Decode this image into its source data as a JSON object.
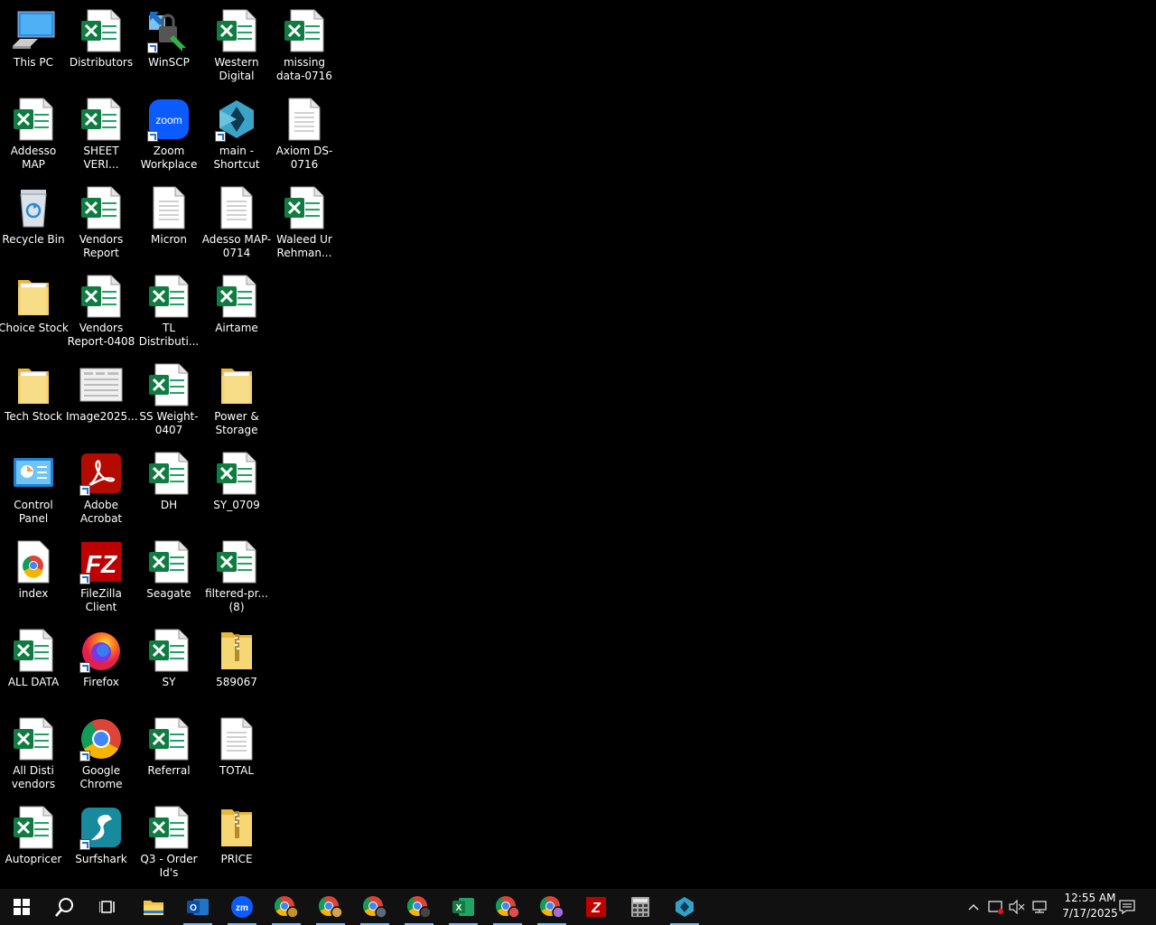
{
  "desktop": {
    "icons": [
      {
        "label": "This PC",
        "type": "pc"
      },
      {
        "label": "Addesso MAP",
        "type": "excel"
      },
      {
        "label": "Recycle Bin",
        "type": "recycle"
      },
      {
        "label": "Choice Stock",
        "type": "folder"
      },
      {
        "label": "Tech Stock",
        "type": "folder"
      },
      {
        "label": "Control Panel",
        "type": "control"
      },
      {
        "label": "index",
        "type": "chromedoc"
      },
      {
        "label": "ALL DATA",
        "type": "excel"
      },
      {
        "label": "All Disti vendors",
        "type": "excel"
      },
      {
        "label": "Autopricer",
        "type": "excel"
      },
      {
        "label": "Distributors",
        "type": "excel"
      },
      {
        "label": "SHEET VERI...",
        "type": "excel"
      },
      {
        "label": "Vendors Report",
        "type": "excel"
      },
      {
        "label": "Vendors Report-0408",
        "type": "excel"
      },
      {
        "label": "Image2025...",
        "type": "image"
      },
      {
        "label": "Adobe Acrobat",
        "type": "acrobat"
      },
      {
        "label": "FileZilla Client",
        "type": "filezilla"
      },
      {
        "label": "Firefox",
        "type": "firefox"
      },
      {
        "label": "Google Chrome",
        "type": "chrome"
      },
      {
        "label": "Surfshark",
        "type": "surfshark"
      },
      {
        "label": "WinSCP",
        "type": "winscp"
      },
      {
        "label": "Zoom Workplace",
        "type": "zoom"
      },
      {
        "label": "Micron",
        "type": "doc"
      },
      {
        "label": "TL Distributi...",
        "type": "excel"
      },
      {
        "label": "SS Weight-0407",
        "type": "excel"
      },
      {
        "label": "DH",
        "type": "excel"
      },
      {
        "label": "Seagate",
        "type": "excel"
      },
      {
        "label": "SY",
        "type": "excel"
      },
      {
        "label": "Referral",
        "type": "excel"
      },
      {
        "label": "Q3 - Order Id's",
        "type": "excel"
      },
      {
        "label": "Western Digital",
        "type": "excel"
      },
      {
        "label": "main - Shortcut",
        "type": "main"
      },
      {
        "label": "Adesso MAP-0714",
        "type": "doc"
      },
      {
        "label": "Airtame",
        "type": "excel"
      },
      {
        "label": "Power & Storage",
        "type": "folder"
      },
      {
        "label": "SY_0709",
        "type": "excel"
      },
      {
        "label": "filtered-pr... (8)",
        "type": "excel"
      },
      {
        "label": "589067",
        "type": "zip"
      },
      {
        "label": "TOTAL",
        "type": "doc"
      },
      {
        "label": "PRICE",
        "type": "zip"
      },
      {
        "label": "missing data-0716",
        "type": "excel"
      },
      {
        "label": "Axiom DS-0716",
        "type": "doc"
      },
      {
        "label": "Waleed Ur Rehman...",
        "type": "excel"
      }
    ]
  },
  "taskbar": {
    "clock_time": "12:55 AM",
    "clock_date": "7/17/2025",
    "zoom_label": "zm",
    "excel_letter": "X",
    "outlook_letter": "O",
    "filezilla_letter": "Z"
  }
}
